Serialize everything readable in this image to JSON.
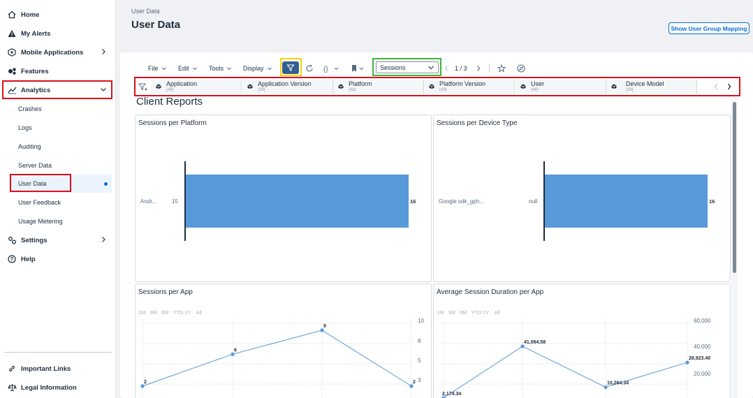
{
  "sidebar": {
    "items": [
      {
        "label": "Home",
        "icon": "home-icon"
      },
      {
        "label": "My Alerts",
        "icon": "alert-icon"
      },
      {
        "label": "Mobile Applications",
        "icon": "mobile-apps-icon"
      },
      {
        "label": "Features",
        "icon": "features-icon"
      },
      {
        "label": "Analytics",
        "icon": "analytics-icon"
      },
      {
        "label": "Settings",
        "icon": "settings-icon"
      },
      {
        "label": "Help",
        "icon": "help-icon"
      }
    ],
    "analytics_sub": [
      {
        "label": "Crashes"
      },
      {
        "label": "Logs"
      },
      {
        "label": "Auditing"
      },
      {
        "label": "Server Data"
      },
      {
        "label": "User Data"
      },
      {
        "label": "User Feedback"
      },
      {
        "label": "Usage Metering"
      }
    ],
    "footer": [
      {
        "label": "Important Links",
        "icon": "link-icon"
      },
      {
        "label": "Legal Information",
        "icon": "legal-icon"
      }
    ]
  },
  "header": {
    "breadcrumb": "User Data",
    "title": "User Data",
    "mapping_button": "Show User Group Mapping"
  },
  "toolbar": {
    "menus": [
      "File",
      "Edit",
      "Tools",
      "Display"
    ],
    "view_select": "Sessions",
    "page_indicator": "1 / 3"
  },
  "filters": [
    {
      "label": "Application",
      "value": "(All)"
    },
    {
      "label": "Application Version",
      "value": "(All)"
    },
    {
      "label": "Platform",
      "value": "(All)"
    },
    {
      "label": "Platform Version",
      "value": "(All)"
    },
    {
      "label": "User",
      "value": "(All)"
    },
    {
      "label": "Device Model",
      "value": "(All)"
    }
  ],
  "section_title": "Client Reports",
  "tiles": {
    "platform": {
      "title": "Sessions per Platform"
    },
    "device": {
      "title": "Sessions per Device Type"
    },
    "app": {
      "title": "Sessions per App"
    },
    "duration": {
      "title": "Average Session Duration per App"
    }
  },
  "periods": [
    "1M",
    "3M",
    "6M",
    "YTD",
    "1Y",
    "All"
  ],
  "colors": {
    "accent": "#0a6ed1",
    "bar": "#5899da",
    "highlight_red": "#d9101c",
    "highlight_yellow": "#f2d30f",
    "highlight_green": "#3cb43c"
  },
  "chart_data": [
    {
      "type": "bar",
      "title": "Sessions per Platform",
      "categories": [
        "Andr..."
      ],
      "category_values": [
        "15"
      ],
      "values": [
        16
      ]
    },
    {
      "type": "bar",
      "title": "Sessions per Device Type",
      "categories": [
        "Google sdk_gph..."
      ],
      "category_values": [
        "null"
      ],
      "values": [
        16
      ]
    },
    {
      "type": "line",
      "title": "Sessions per App",
      "values": [
        2,
        6,
        9,
        2
      ],
      "y_ticks": [
        "10",
        "8",
        "5",
        "3"
      ]
    },
    {
      "type": "line",
      "title": "Average Session Duration per App",
      "values": [
        2174.34,
        41064.58,
        10264.34,
        28923.4
      ],
      "value_labels": [
        "2,174.34",
        "41,064.58",
        "10,264.34",
        "28,923.40"
      ],
      "y_ticks": [
        "60,000",
        "40,000",
        "20,000"
      ]
    }
  ]
}
